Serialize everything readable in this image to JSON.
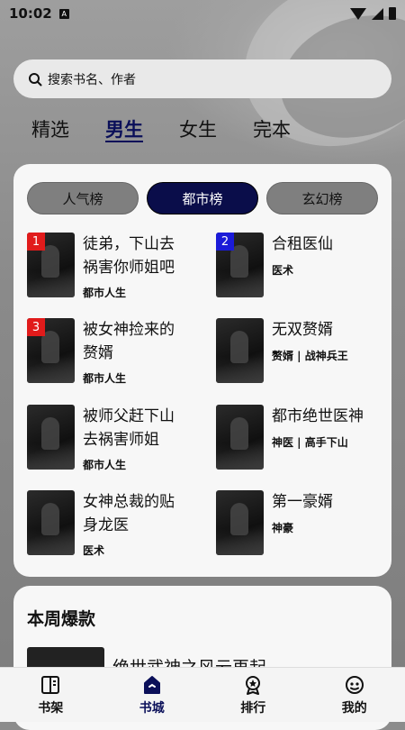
{
  "status_bar": {
    "time": "10:02",
    "notif_icon_label": "A"
  },
  "search": {
    "placeholder": "搜索书名、作者"
  },
  "tabs": [
    {
      "label": "精选",
      "active": false
    },
    {
      "label": "男生",
      "active": true
    },
    {
      "label": "女生",
      "active": false
    },
    {
      "label": "完本",
      "active": false
    }
  ],
  "segments": [
    {
      "label": "人气榜",
      "active": false
    },
    {
      "label": "都市榜",
      "active": true
    },
    {
      "label": "玄幻榜",
      "active": false
    }
  ],
  "books": [
    {
      "rank": "1",
      "title": "徒弟，下山去祸害你师姐吧",
      "tag": "都市人生"
    },
    {
      "rank": "2",
      "title": "合租医仙",
      "tag": "医术"
    },
    {
      "rank": "3",
      "title": "被女神捡来的赘婿",
      "tag": "都市人生"
    },
    {
      "rank": "",
      "title": "无双赘婿",
      "tag": "赘婿 | 战神兵王"
    },
    {
      "rank": "",
      "title": "被师父赶下山去祸害师姐",
      "tag": "都市人生"
    },
    {
      "rank": "",
      "title": "都市绝世医神",
      "tag": "神医 | 高手下山"
    },
    {
      "rank": "",
      "title": "女神总裁的贴身龙医",
      "tag": "医术"
    },
    {
      "rank": "",
      "title": "第一豪婿",
      "tag": "神豪"
    }
  ],
  "weekly": {
    "title": "本周爆款",
    "first_book_title": "绝世武神之风云再起"
  },
  "bottom_nav": [
    {
      "label": "书架",
      "icon": "bookshelf-icon",
      "active": false
    },
    {
      "label": "书城",
      "icon": "store-icon",
      "active": true
    },
    {
      "label": "排行",
      "icon": "ranking-icon",
      "active": false
    },
    {
      "label": "我的",
      "icon": "profile-icon",
      "active": false
    }
  ],
  "colors": {
    "accent": "#0a0f59",
    "rank_red": "#e11b1b",
    "rank_blue": "#1b1bd8"
  }
}
